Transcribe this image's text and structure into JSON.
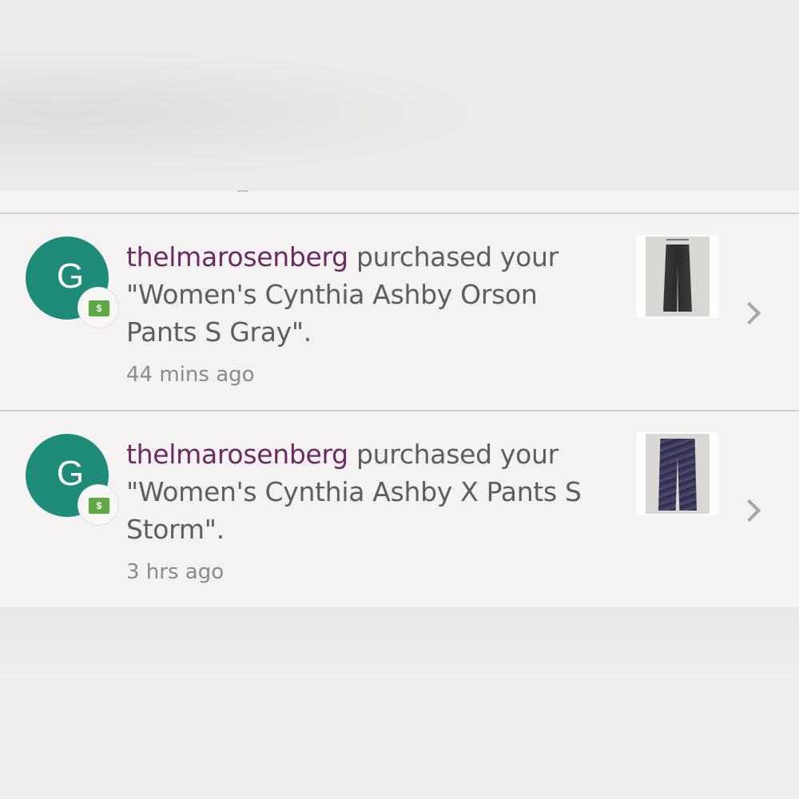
{
  "notifications": [
    {
      "avatar_letter": "G",
      "badge_icon": "$",
      "username": "thelmarosenberg",
      "action": " purchased your",
      "item_text": "\"Women's Cynthia Ashby Orson Pants S Gray\".",
      "time": "44 mins ago",
      "thumbnail_icon": "gray-pants-thumbnail",
      "chevron_icon": "chevron-right-icon"
    },
    {
      "avatar_letter": "G",
      "badge_icon": "$",
      "username": "thelmarosenberg",
      "action": " purchased your",
      "item_text": "\"Women's Cynthia Ashby X Pants S Storm\".",
      "time": "3 hrs ago",
      "thumbnail_icon": "storm-pants-thumbnail",
      "chevron_icon": "chevron-right-icon"
    }
  ],
  "colors": {
    "avatar_bg": "#1e8c78",
    "username": "#6b2a62",
    "body_text": "#5e5e5e",
    "time_text": "#8b8b8b",
    "badge_bill": "#5fa944"
  }
}
